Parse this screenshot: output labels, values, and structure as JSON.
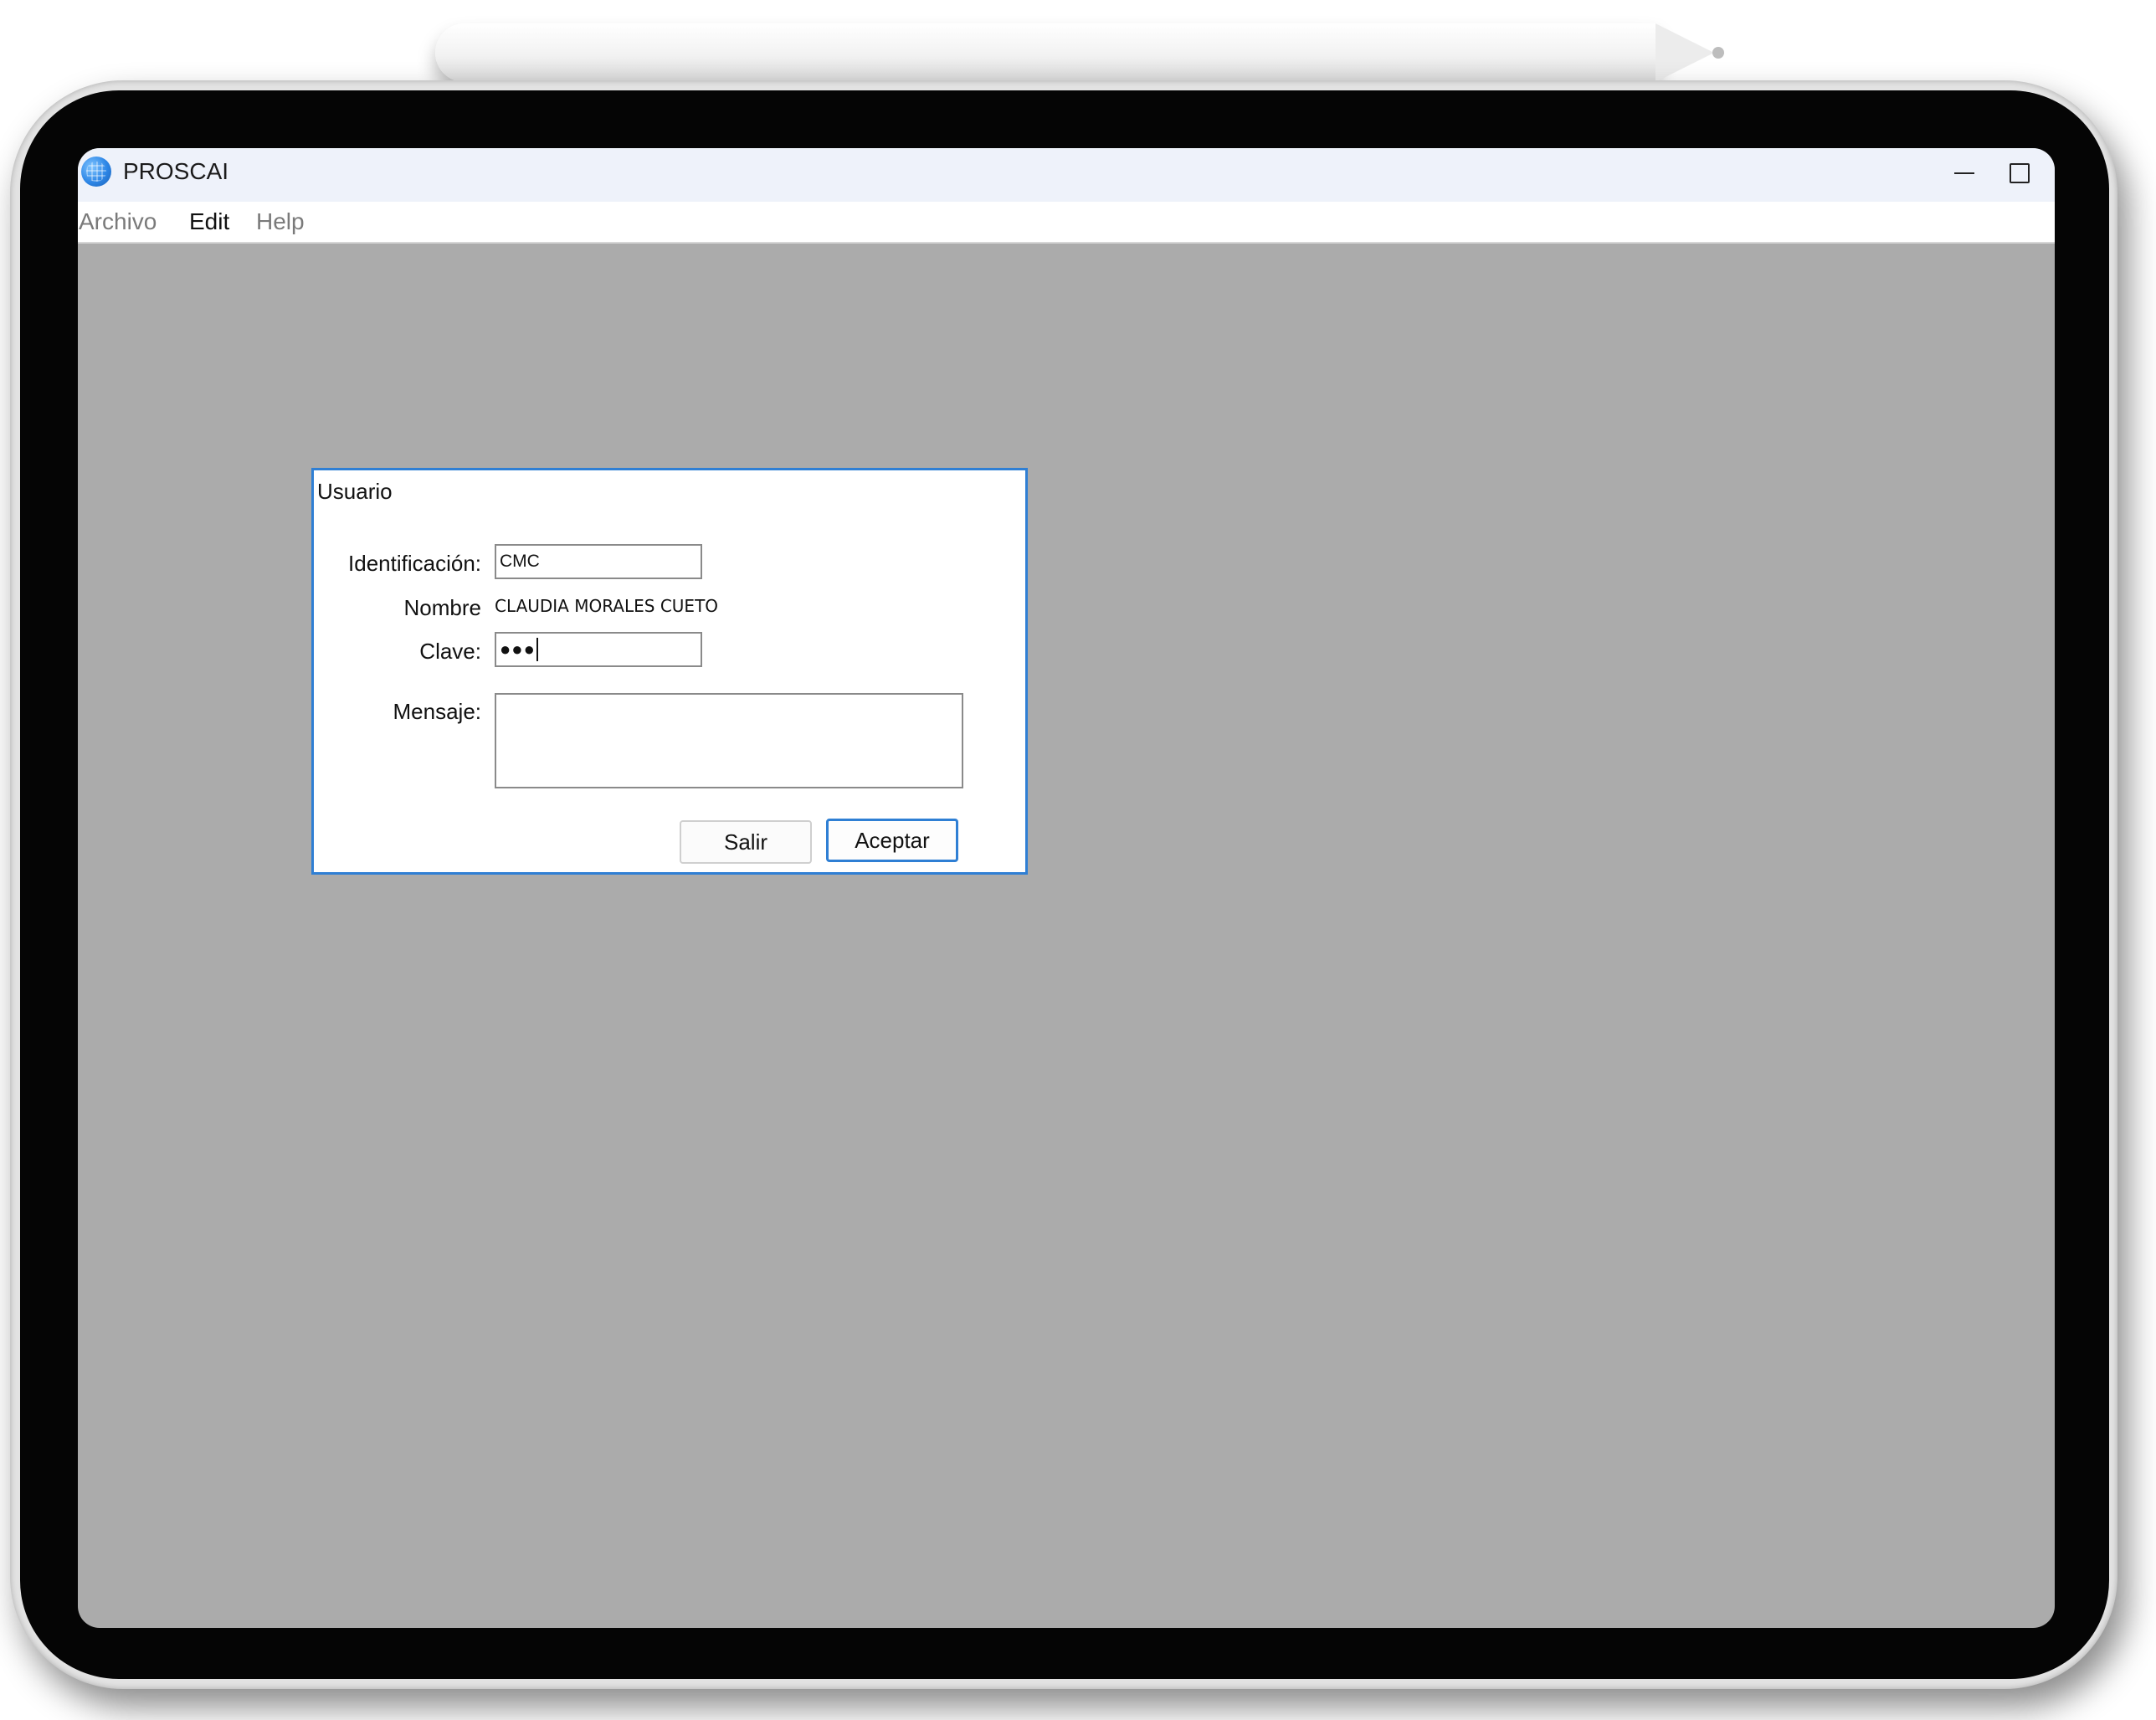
{
  "window": {
    "title": "PROSCAI"
  },
  "menubar": {
    "items": [
      {
        "label": "Archivo"
      },
      {
        "label": "Edit"
      },
      {
        "label": "Help"
      }
    ]
  },
  "dialog": {
    "title": "Usuario",
    "identificacion": {
      "label": "Identificación:",
      "value": "CMC"
    },
    "nombre": {
      "label": "Nombre",
      "value": "CLAUDIA MORALES CUETO"
    },
    "clave": {
      "label": "Clave:",
      "masked_value": "●●●"
    },
    "mensaje": {
      "label": "Mensaje:",
      "value": ""
    },
    "buttons": {
      "salir": "Salir",
      "aceptar": "Aceptar"
    }
  },
  "colors": {
    "accent": "#2f7fd4",
    "desktop": "#ababab",
    "titlebar": "#eef2fa"
  }
}
